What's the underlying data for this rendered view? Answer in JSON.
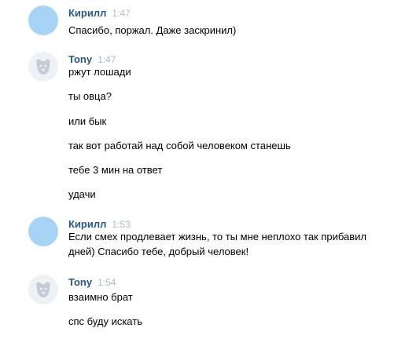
{
  "messages": [
    {
      "author": "Кирилл",
      "time": "1:47",
      "avatar": "blue-circle",
      "lines": [
        "Спасибо, поржал. Даже заскринил)"
      ]
    },
    {
      "author": "Tony",
      "time": "1:47",
      "avatar": "dog-icon",
      "lines": [
        "ржут лошади",
        "ты овца?",
        "или бык",
        "так вот работай над собой человеком станешь",
        "тебе 3 мин на ответ",
        "удачи"
      ]
    },
    {
      "author": "Кирилл",
      "time": "1:53",
      "avatar": "blue-circle",
      "lines": [
        "Если смех продлевает жизнь, то ты мне неплохо так прибавил",
        "дней) Спасибо тебе, добрый человек!"
      ]
    },
    {
      "author": "Tony",
      "time": "1:54",
      "avatar": "dog-icon",
      "lines": [
        "взаимно брат",
        "спс буду искать"
      ]
    }
  ],
  "colors": {
    "author": "#2a5885",
    "time": "#aeb9c6",
    "avatar_blue": "#a7d3f4",
    "avatar_dog_bg": "#eef1f5",
    "dog_icon": "#c5ccd6"
  }
}
